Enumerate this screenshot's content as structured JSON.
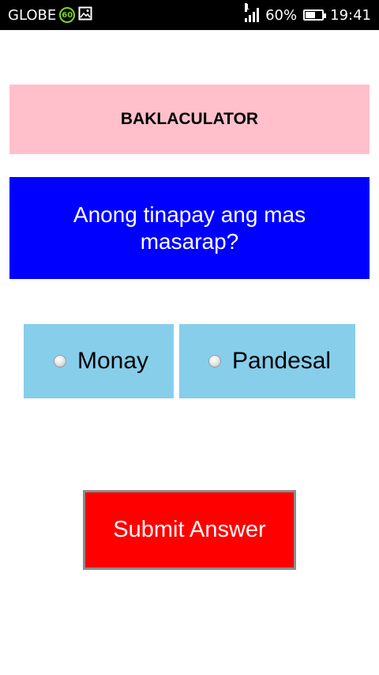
{
  "status_bar": {
    "carrier": "GLOBE",
    "network_badge": "60",
    "sim_slot": "1",
    "battery_percent": "60%",
    "battery_level": 0.6,
    "time": "19:41",
    "icons": [
      "network-badge-icon",
      "gallery-icon",
      "signal-icon",
      "battery-icon"
    ]
  },
  "app": {
    "title": "BAKLACULATOR"
  },
  "question": {
    "text": "Anong tinapay ang mas masarap?"
  },
  "options": [
    {
      "label": "Monay",
      "selected": false
    },
    {
      "label": "Pandesal",
      "selected": false
    }
  ],
  "submit": {
    "label": "Submit Answer"
  },
  "colors": {
    "title_bg": "#ffc0cb",
    "question_bg": "#0000ff",
    "option_bg": "#87ceeb",
    "submit_bg": "#ff0000"
  }
}
